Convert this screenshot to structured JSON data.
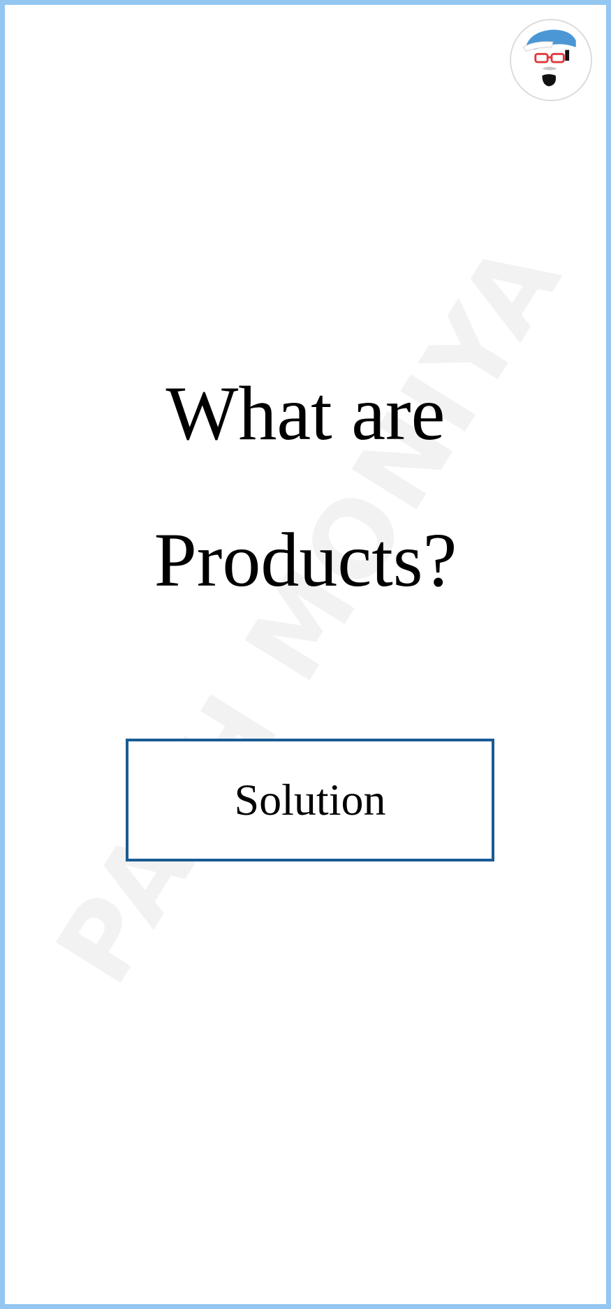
{
  "watermark": "PATH MONIYA",
  "title": {
    "line1": "What are",
    "line2": "Products?"
  },
  "solution_button": {
    "label": "Solution"
  },
  "colors": {
    "frame_border": "#93c6f0",
    "button_border": "#1a5b94",
    "text": "#000000",
    "watermark": "#f2f2f2"
  },
  "icons": {
    "avatar": "cartoon-face-avatar-icon"
  }
}
